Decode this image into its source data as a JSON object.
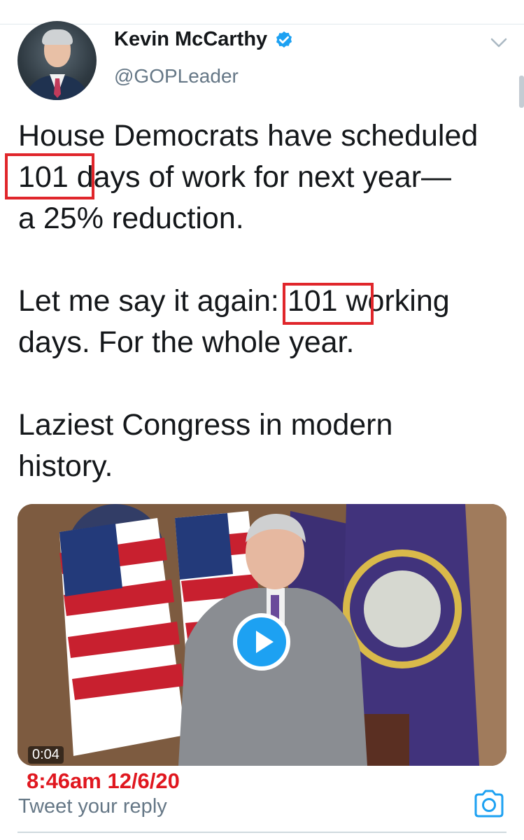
{
  "author": {
    "name": "Kevin McCarthy",
    "handle": "@GOPLeader",
    "verified": true,
    "avatar_icon": "profile-photo"
  },
  "tweet": {
    "lines": [
      "House Democrats have scheduled",
      "101 days of work for next year—",
      "a 25% reduction.",
      "",
      "Let me say it again: 101 working",
      "days. For the whole year.",
      "",
      "Laziest Congress in modern",
      "history."
    ]
  },
  "media": {
    "type": "video",
    "duration": "0:04",
    "play_icon": "play-icon"
  },
  "annotation": {
    "timestamp": "8:46am 12/6/20",
    "highlight_color": "#e0262b"
  },
  "reply": {
    "placeholder": "Tweet your reply",
    "camera_icon": "camera-icon"
  },
  "colors": {
    "accent": "#1da1f2",
    "text": "#14171a",
    "secondary_text": "#657786",
    "annotation_red": "#e0171f"
  }
}
